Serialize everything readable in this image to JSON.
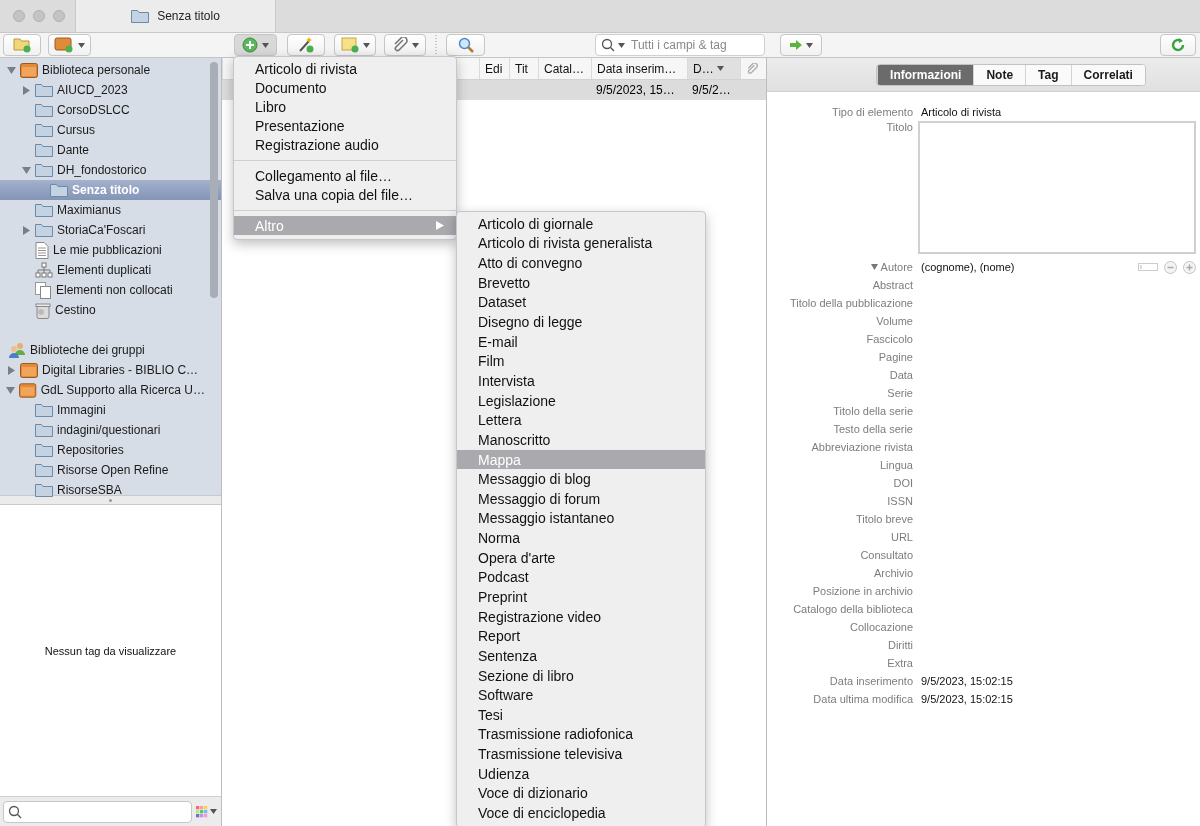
{
  "window": {
    "tab_title": "Senza titolo"
  },
  "toolbar": {
    "search_placeholder": "Tutti i campi & tag"
  },
  "collections": [
    {
      "label": "Biblioteca personale",
      "kind": "library",
      "expanded": true,
      "selected": false,
      "children": [
        {
          "label": "AIUCD_2023",
          "kind": "folder",
          "expanded": false,
          "selected": false
        },
        {
          "label": "CorsoDSLCC",
          "kind": "folder",
          "selected": false
        },
        {
          "label": "Cursus",
          "kind": "folder",
          "selected": false
        },
        {
          "label": "Dante",
          "kind": "folder",
          "selected": false
        },
        {
          "label": "DH_fondostorico",
          "kind": "folder",
          "expanded": true,
          "selected": false,
          "children": [
            {
              "label": "Senza titolo",
              "kind": "folder",
              "selected": true
            }
          ]
        },
        {
          "label": "Maximianus",
          "kind": "folder",
          "selected": false
        },
        {
          "label": "StoriaCa'Foscari",
          "kind": "folder",
          "expanded": false,
          "selected": false
        },
        {
          "label": "Le mie pubblicazioni",
          "kind": "publications",
          "selected": false
        },
        {
          "label": "Elementi duplicati",
          "kind": "duplicates",
          "selected": false
        },
        {
          "label": "Elementi non collocati",
          "kind": "unfiled",
          "selected": false
        },
        {
          "label": "Cestino",
          "kind": "trash",
          "selected": false
        }
      ]
    },
    {
      "label": "Biblioteche dei gruppi",
      "kind": "groups-header",
      "selected": false
    },
    {
      "label": "Digital Libraries - BIBLIO C…",
      "kind": "library",
      "expanded": false,
      "selected": false
    },
    {
      "label": "GdL Supporto alla Ricerca U…",
      "kind": "library",
      "expanded": true,
      "selected": false,
      "children": [
        {
          "label": "Immagini",
          "kind": "folder",
          "selected": false
        },
        {
          "label": "indagini/questionari",
          "kind": "folder",
          "selected": false
        },
        {
          "label": "Repositories",
          "kind": "folder",
          "selected": false
        },
        {
          "label": "Risorse Open Refine",
          "kind": "folder",
          "selected": false
        },
        {
          "label": "RisorseSBA",
          "kind": "folder",
          "selected": false
        }
      ]
    }
  ],
  "tag_selector": {
    "empty_message": "Nessun tag da visualizzare"
  },
  "items_table": {
    "columns": [
      {
        "label": "Edi",
        "sorted": false
      },
      {
        "label": "Tit",
        "sorted": false
      },
      {
        "label": "Catal…",
        "sorted": false
      },
      {
        "label": "Data inserim…",
        "sorted": false
      },
      {
        "label": "D…",
        "sorted": true
      }
    ],
    "rows": [
      {
        "selected": true,
        "cells": [
          null,
          null,
          null,
          "9/5/2023, 15…",
          "9/5/2…"
        ]
      }
    ]
  },
  "item_pane": {
    "tabs": [
      {
        "label": "Informazioni",
        "selected": true
      },
      {
        "label": "Note",
        "selected": false
      },
      {
        "label": "Tag",
        "selected": false
      },
      {
        "label": "Correlati",
        "selected": false
      }
    ],
    "fields": [
      {
        "label": "Tipo di elemento",
        "kind": "text",
        "value": "Articolo di rivista"
      },
      {
        "label": "Titolo",
        "kind": "textarea"
      },
      {
        "label": "Autore",
        "kind": "creator",
        "value": "(cognome), (nome)",
        "expanded": true
      },
      {
        "label": "Abstract",
        "kind": "text"
      },
      {
        "label": "Titolo della pubblicazione",
        "kind": "text"
      },
      {
        "label": "Volume",
        "kind": "text"
      },
      {
        "label": "Fascicolo",
        "kind": "text"
      },
      {
        "label": "Pagine",
        "kind": "text"
      },
      {
        "label": "Data",
        "kind": "text"
      },
      {
        "label": "Serie",
        "kind": "text"
      },
      {
        "label": "Titolo della serie",
        "kind": "text"
      },
      {
        "label": "Testo della serie",
        "kind": "text"
      },
      {
        "label": "Abbreviazione rivista",
        "kind": "text"
      },
      {
        "label": "Lingua",
        "kind": "text"
      },
      {
        "label": "DOI",
        "kind": "text"
      },
      {
        "label": "ISSN",
        "kind": "text"
      },
      {
        "label": "Titolo breve",
        "kind": "text"
      },
      {
        "label": "URL",
        "kind": "text"
      },
      {
        "label": "Consultato",
        "kind": "text"
      },
      {
        "label": "Archivio",
        "kind": "text"
      },
      {
        "label": "Posizione in archivio",
        "kind": "text"
      },
      {
        "label": "Catalogo della biblioteca",
        "kind": "text"
      },
      {
        "label": "Collocazione",
        "kind": "text"
      },
      {
        "label": "Diritti",
        "kind": "text"
      },
      {
        "label": "Extra",
        "kind": "text"
      },
      {
        "label": "Data inserimento",
        "kind": "text",
        "value": "9/5/2023, 15:02:15"
      },
      {
        "label": "Data ultima modifica",
        "kind": "text",
        "value": "9/5/2023, 15:02:15"
      }
    ]
  },
  "new_item_menu": {
    "groups": [
      [
        {
          "label": "Articolo di rivista",
          "selected": false
        },
        {
          "label": "Documento",
          "selected": false
        },
        {
          "label": "Libro",
          "selected": false
        },
        {
          "label": "Presentazione",
          "selected": false
        },
        {
          "label": "Registrazione audio",
          "selected": false
        }
      ],
      [
        {
          "label": "Collegamento al file…",
          "selected": false
        },
        {
          "label": "Salva una copia del file…",
          "selected": false
        }
      ],
      [
        {
          "label": "Altro",
          "selected": true,
          "submenu": true
        }
      ]
    ]
  },
  "submenu": {
    "items": [
      {
        "label": "Articolo di giornale",
        "selected": false
      },
      {
        "label": "Articolo di rivista generalista",
        "selected": false
      },
      {
        "label": "Atto di convegno",
        "selected": false
      },
      {
        "label": "Brevetto",
        "selected": false
      },
      {
        "label": "Dataset",
        "selected": false
      },
      {
        "label": "Disegno di legge",
        "selected": false
      },
      {
        "label": "E-mail",
        "selected": false
      },
      {
        "label": "Film",
        "selected": false
      },
      {
        "label": "Intervista",
        "selected": false
      },
      {
        "label": "Legislazione",
        "selected": false
      },
      {
        "label": "Lettera",
        "selected": false
      },
      {
        "label": "Manoscritto",
        "selected": false
      },
      {
        "label": "Mappa",
        "selected": true
      },
      {
        "label": "Messaggio di blog",
        "selected": false
      },
      {
        "label": "Messaggio di forum",
        "selected": false
      },
      {
        "label": "Messaggio istantaneo",
        "selected": false
      },
      {
        "label": "Norma",
        "selected": false
      },
      {
        "label": "Opera d'arte",
        "selected": false
      },
      {
        "label": "Podcast",
        "selected": false
      },
      {
        "label": "Preprint",
        "selected": false
      },
      {
        "label": "Registrazione video",
        "selected": false
      },
      {
        "label": "Report",
        "selected": false
      },
      {
        "label": "Sentenza",
        "selected": false
      },
      {
        "label": "Sezione di libro",
        "selected": false
      },
      {
        "label": "Software",
        "selected": false
      },
      {
        "label": "Tesi",
        "selected": false
      },
      {
        "label": "Trasmissione radiofonica",
        "selected": false
      },
      {
        "label": "Trasmissione televisiva",
        "selected": false
      },
      {
        "label": "Udienza",
        "selected": false
      },
      {
        "label": "Voce di dizionario",
        "selected": false
      },
      {
        "label": "Voce di enciclopedia",
        "selected": false
      }
    ]
  }
}
